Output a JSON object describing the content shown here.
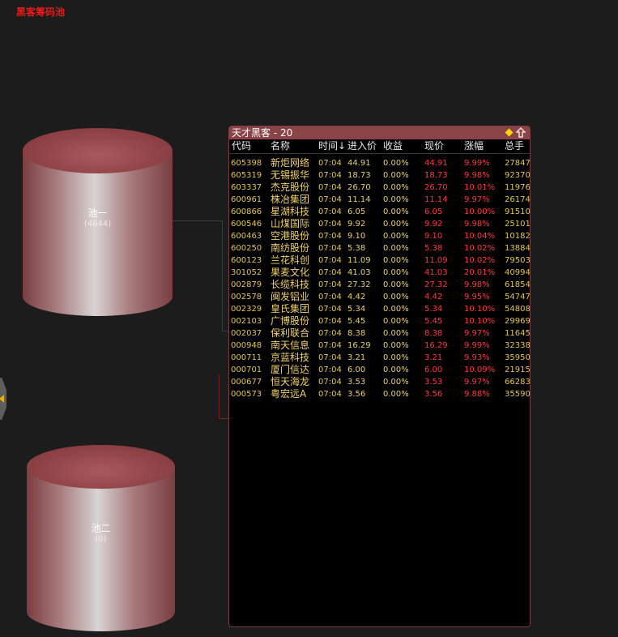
{
  "app_title": "黑客筹码池",
  "pools": [
    {
      "name": "池一",
      "count": "(4644)"
    },
    {
      "name": "池二",
      "count": "(0)"
    }
  ],
  "panel": {
    "title": "天才黑客 - 20",
    "columns": [
      "代码",
      "名称",
      "时间↓",
      "进入价",
      "收益",
      "现价",
      "涨幅",
      "总手"
    ],
    "rows": [
      {
        "code": "605398",
        "name": "新炬网络",
        "time": "07:04",
        "entry": "44.91",
        "gain": "0.00%",
        "price": "44.91",
        "change": "9.99%",
        "volume": "27847"
      },
      {
        "code": "605319",
        "name": "无锡振华",
        "time": "07:04",
        "entry": "18.73",
        "gain": "0.00%",
        "price": "18.73",
        "change": "9.98%",
        "volume": "92370"
      },
      {
        "code": "603337",
        "name": "杰克股份",
        "time": "07:04",
        "entry": "26.70",
        "gain": "0.00%",
        "price": "26.70",
        "change": "10.01%",
        "volume": "11976"
      },
      {
        "code": "600961",
        "name": "株冶集团",
        "time": "07:04",
        "entry": "11.14",
        "gain": "0.00%",
        "price": "11.14",
        "change": "9.97%",
        "volume": "26174"
      },
      {
        "code": "600866",
        "name": "星湖科技",
        "time": "07:04",
        "entry": "6.05",
        "gain": "0.00%",
        "price": "6.05",
        "change": "10.00%",
        "volume": "91510"
      },
      {
        "code": "600546",
        "name": "山煤国际",
        "time": "07:04",
        "entry": "9.92",
        "gain": "0.00%",
        "price": "9.92",
        "change": "9.98%",
        "volume": "25101"
      },
      {
        "code": "600463",
        "name": "空港股份",
        "time": "07:04",
        "entry": "9.10",
        "gain": "0.00%",
        "price": "9.10",
        "change": "10.04%",
        "volume": "10182"
      },
      {
        "code": "600250",
        "name": "南纺股份",
        "time": "07:04",
        "entry": "5.38",
        "gain": "0.00%",
        "price": "5.38",
        "change": "10.02%",
        "volume": "13884"
      },
      {
        "code": "600123",
        "name": "兰花科创",
        "time": "07:04",
        "entry": "11.09",
        "gain": "0.00%",
        "price": "11.09",
        "change": "10.02%",
        "volume": "79503"
      },
      {
        "code": "301052",
        "name": "果麦文化",
        "time": "07:04",
        "entry": "41.03",
        "gain": "0.00%",
        "price": "41.03",
        "change": "20.01%",
        "volume": "40994"
      },
      {
        "code": "002879",
        "name": "长缆科技",
        "time": "07:04",
        "entry": "27.32",
        "gain": "0.00%",
        "price": "27.32",
        "change": "9.98%",
        "volume": "61854"
      },
      {
        "code": "002578",
        "name": "闽发铝业",
        "time": "07:04",
        "entry": "4.42",
        "gain": "0.00%",
        "price": "4.42",
        "change": "9.95%",
        "volume": "54747"
      },
      {
        "code": "002329",
        "name": "皇氏集团",
        "time": "07:04",
        "entry": "5.34",
        "gain": "0.00%",
        "price": "5.34",
        "change": "10.10%",
        "volume": "54808"
      },
      {
        "code": "002103",
        "name": "广博股份",
        "time": "07:04",
        "entry": "5.45",
        "gain": "0.00%",
        "price": "5.45",
        "change": "10.10%",
        "volume": "29969"
      },
      {
        "code": "002037",
        "name": "保利联合",
        "time": "07:04",
        "entry": "8.38",
        "gain": "0.00%",
        "price": "8.38",
        "change": "9.97%",
        "volume": "11645"
      },
      {
        "code": "000948",
        "name": "南天信息",
        "time": "07:04",
        "entry": "16.29",
        "gain": "0.00%",
        "price": "16.29",
        "change": "9.99%",
        "volume": "32338"
      },
      {
        "code": "000711",
        "name": "京蓝科技",
        "time": "07:04",
        "entry": "3.21",
        "gain": "0.00%",
        "price": "3.21",
        "change": "9.93%",
        "volume": "35950"
      },
      {
        "code": "000701",
        "name": "厦门信达",
        "time": "07:04",
        "entry": "6.00",
        "gain": "0.00%",
        "price": "6.00",
        "change": "10.09%",
        "volume": "21915"
      },
      {
        "code": "000677",
        "name": "恒天海龙",
        "time": "07:04",
        "entry": "3.53",
        "gain": "0.00%",
        "price": "3.53",
        "change": "9.97%",
        "volume": "66283"
      },
      {
        "code": "000573",
        "name": "粤宏远A",
        "time": "07:04",
        "entry": "3.56",
        "gain": "0.00%",
        "price": "3.56",
        "change": "9.88%",
        "volume": "35590"
      }
    ]
  },
  "icons": {
    "panel_pin": "diamond-icon",
    "panel_up": "up-arrow-icon",
    "side_handle": "chevron-left-icon"
  },
  "colors": {
    "title_red": "#e81a1a",
    "panel_header": "#8a4447",
    "price_red": "#ff3a3a",
    "text_yellow": "#e2c458"
  }
}
